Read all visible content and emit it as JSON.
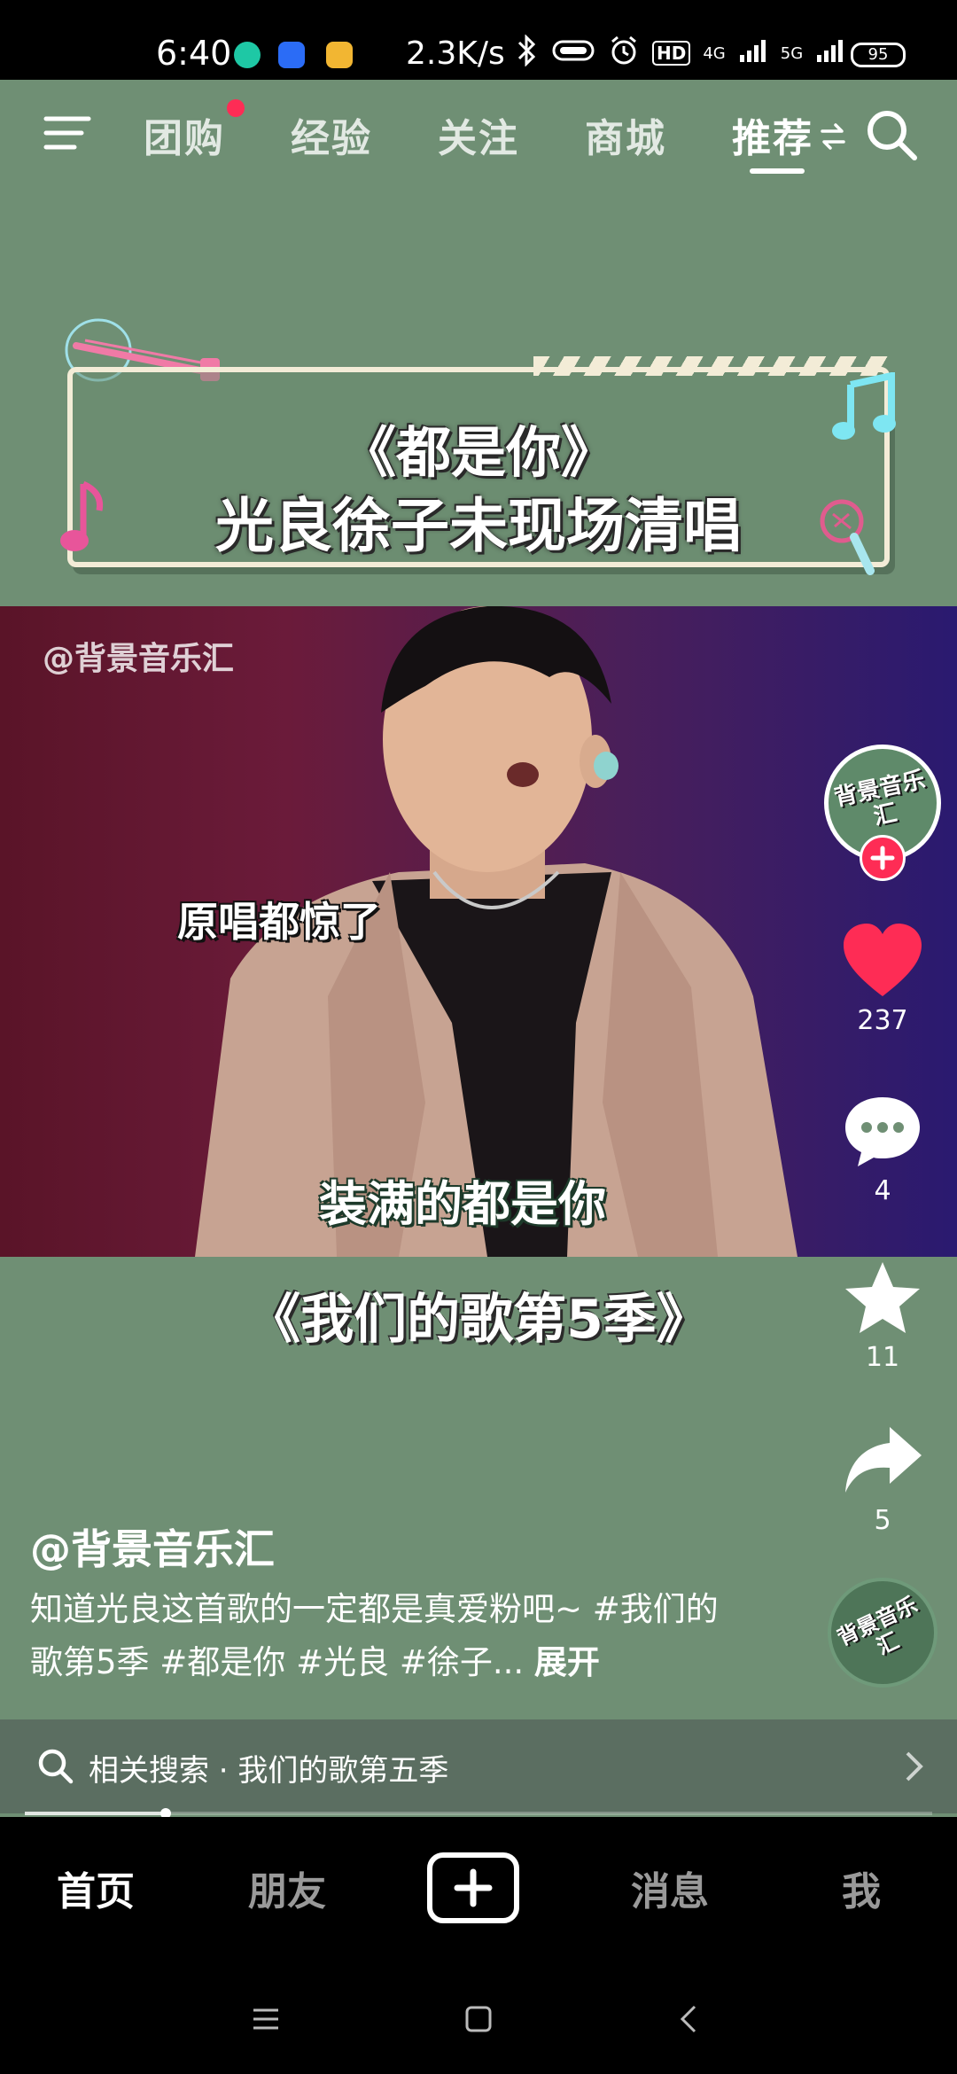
{
  "status_bar": {
    "time": "6:40",
    "speed": "2.3K/s",
    "network_1": "HD",
    "network_2": "4G",
    "network_3": "5G",
    "battery": "95"
  },
  "top_nav": {
    "tabs": [
      {
        "label": "团购",
        "badge": true
      },
      {
        "label": "经验"
      },
      {
        "label": "关注"
      },
      {
        "label": "商城"
      },
      {
        "label": "推荐",
        "active": true
      }
    ]
  },
  "video": {
    "banner_line1": "《都是你》",
    "banner_line2": "光良徐子未现场清唱",
    "watermark": "@背景音乐汇",
    "caption_1": "原唱都惊了",
    "caption_2": "装满的都是你",
    "subtitle": "《我们的歌第5季》"
  },
  "creator": {
    "avatar_text": "背景音乐汇",
    "handle": "@背景音乐汇"
  },
  "actions": {
    "likes": "237",
    "comments": "4",
    "favorites": "11",
    "shares": "5"
  },
  "description": {
    "text": "知道光良这首歌的一定都是真爱粉吧~ #我们的歌第5季 #都是你 #光良 #徐子...",
    "more": "展开"
  },
  "music": {
    "disc_text": "背景音乐汇"
  },
  "related_search": {
    "label": "相关搜索 · 我们的歌第五季"
  },
  "playback": {
    "progress": 0.155
  },
  "bottom_nav": {
    "home": "首页",
    "friends": "朋友",
    "messages": "消息",
    "me": "我"
  },
  "colors": {
    "accent": "#fe2c55",
    "background": "#6f8f74"
  }
}
